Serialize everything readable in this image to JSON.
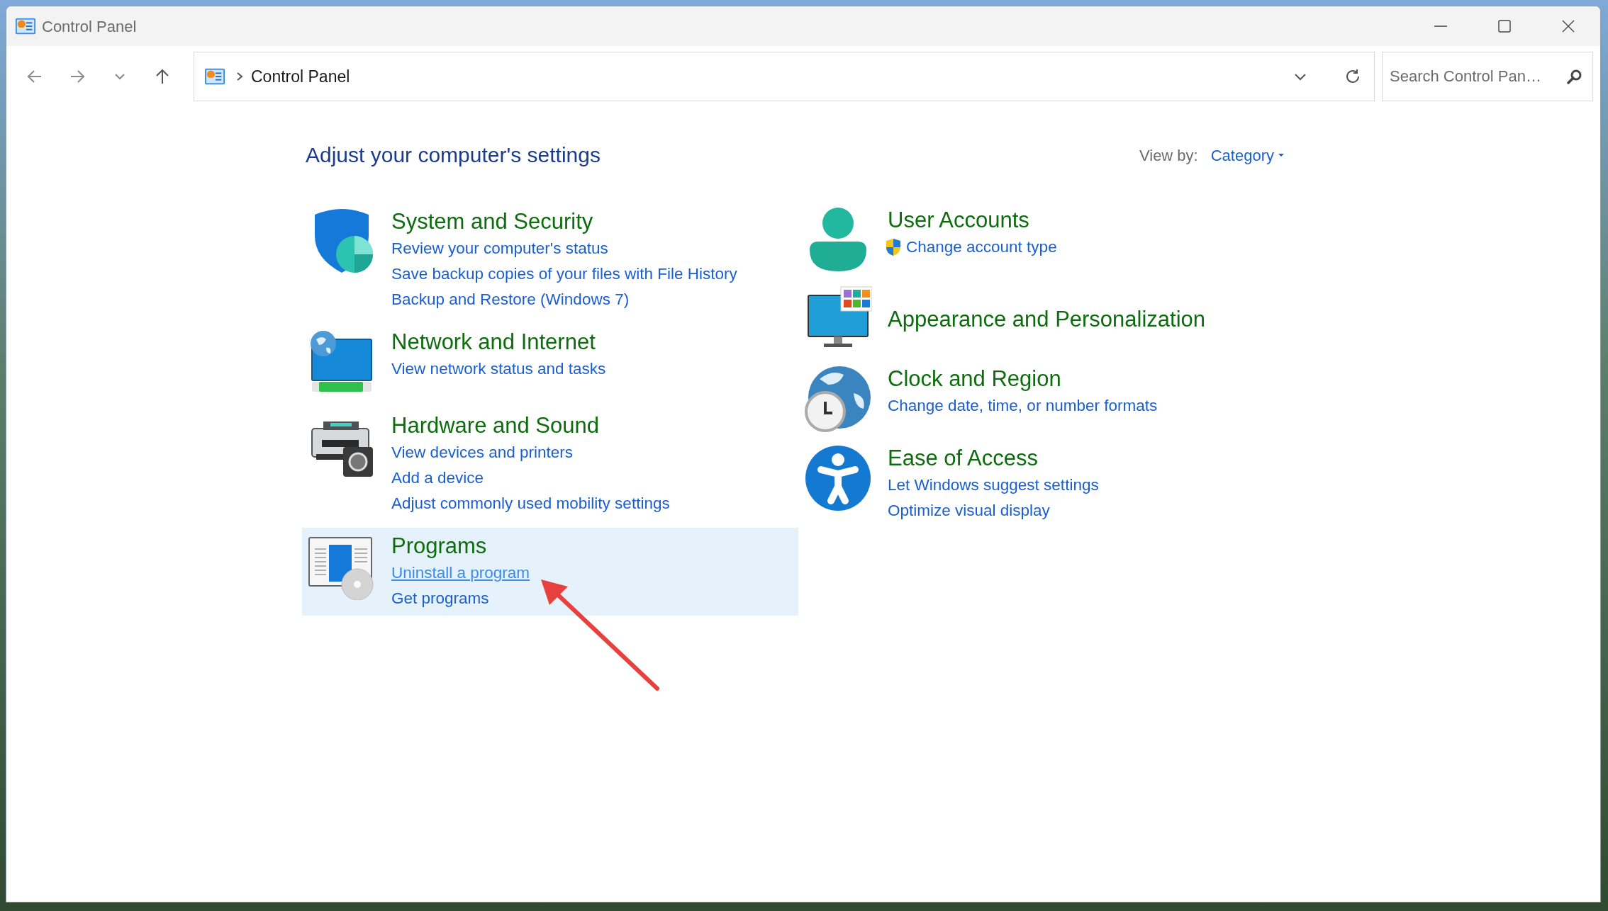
{
  "window": {
    "title": "Control Panel"
  },
  "address_bar": {
    "breadcrumb": "Control Panel"
  },
  "search": {
    "placeholder": "Search Control Pan…"
  },
  "heading": "Adjust your computer's settings",
  "view_by": {
    "label": "View by:",
    "value": "Category"
  },
  "columns": [
    [
      {
        "kind": "shield",
        "title": "System and Security",
        "highlighted": false,
        "links": [
          {
            "text": "Review your computer's status",
            "hovered": false
          },
          {
            "text": "Save backup copies of your files with File History",
            "hovered": false
          },
          {
            "text": "Backup and Restore (Windows 7)",
            "hovered": false
          }
        ]
      },
      {
        "kind": "network",
        "title": "Network and Internet",
        "highlighted": false,
        "links": [
          {
            "text": "View network status and tasks",
            "hovered": false
          }
        ]
      },
      {
        "kind": "hardware",
        "title": "Hardware and Sound",
        "highlighted": false,
        "links": [
          {
            "text": "View devices and printers",
            "hovered": false
          },
          {
            "text": "Add a device",
            "hovered": false
          },
          {
            "text": "Adjust commonly used mobility settings",
            "hovered": false
          }
        ]
      },
      {
        "kind": "programs",
        "title": "Programs",
        "highlighted": true,
        "links": [
          {
            "text": "Uninstall a program",
            "hovered": true
          },
          {
            "text": "Get programs",
            "hovered": false
          }
        ]
      }
    ],
    [
      {
        "kind": "user",
        "title": "User Accounts",
        "highlighted": false,
        "links": [
          {
            "text": "Change account type",
            "hovered": false,
            "admin": true
          }
        ]
      },
      {
        "kind": "appearance",
        "title": "Appearance and Personalization",
        "highlighted": false
      },
      {
        "kind": "clock",
        "title": "Clock and Region",
        "highlighted": false,
        "links": [
          {
            "text": "Change date, time, or number formats",
            "hovered": false
          }
        ]
      },
      {
        "kind": "access",
        "title": "Ease of Access",
        "highlighted": false,
        "links": [
          {
            "text": "Let Windows suggest settings",
            "hovered": false
          },
          {
            "text": "Optimize visual display",
            "hovered": false
          }
        ]
      }
    ]
  ]
}
